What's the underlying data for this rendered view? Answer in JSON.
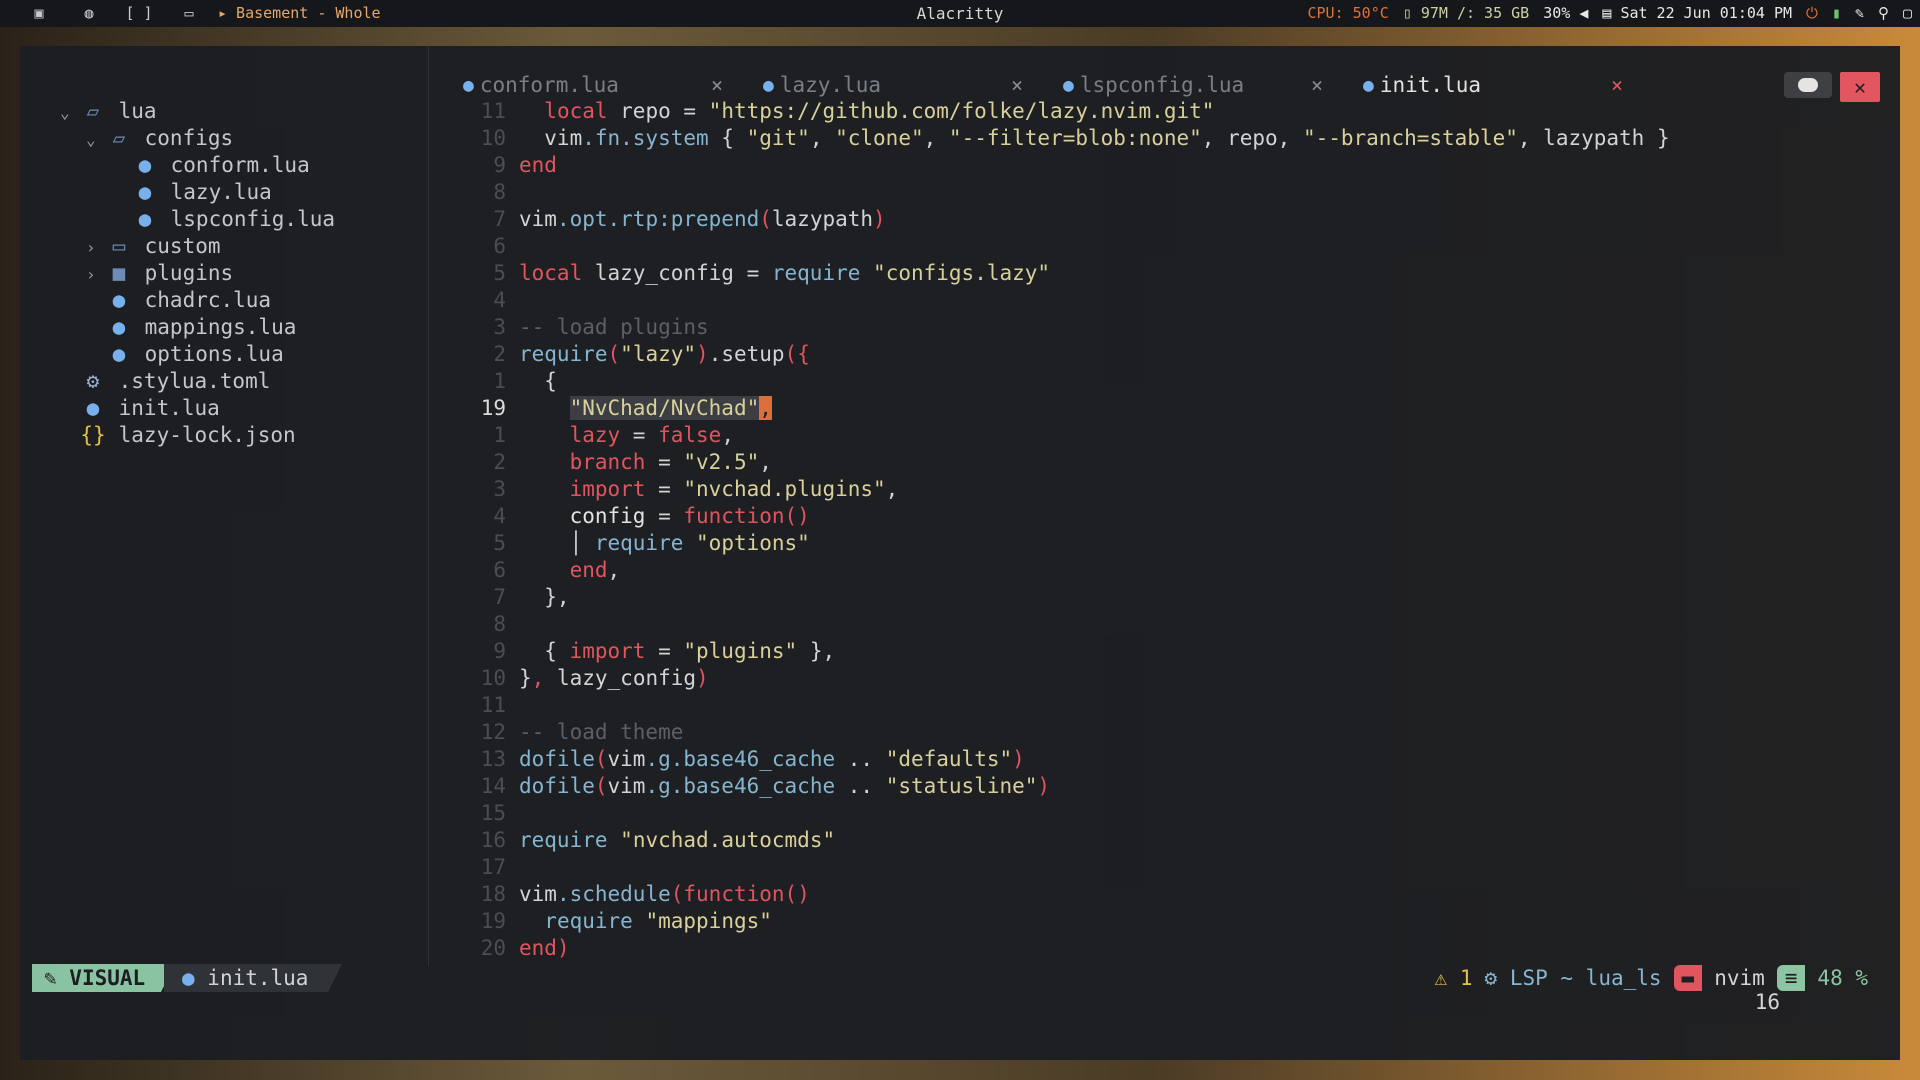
{
  "topbar": {
    "workspace": "▸ Basement - Whole",
    "title": "Alacritty",
    "cpu": "CPU: 50°C",
    "mem": "97M /: 35 GB",
    "volume": "30%",
    "datetime": "Sat 22 Jun 01:04 PM",
    "icons": [
      "terminal-icon",
      "globe-icon",
      "code-icon",
      "folder-icon"
    ]
  },
  "tree": [
    {
      "depth": 0,
      "open": true,
      "kind": "folder-open",
      "label": "lua"
    },
    {
      "depth": 1,
      "open": true,
      "kind": "folder-open",
      "label": "configs"
    },
    {
      "depth": 2,
      "kind": "lua",
      "label": "conform.lua"
    },
    {
      "depth": 2,
      "kind": "lua",
      "label": "lazy.lua"
    },
    {
      "depth": 2,
      "kind": "lua",
      "label": "lspconfig.lua"
    },
    {
      "depth": 1,
      "open": false,
      "kind": "folder",
      "label": "custom"
    },
    {
      "depth": 1,
      "open": false,
      "kind": "folder-filled",
      "label": "plugins"
    },
    {
      "depth": 1,
      "kind": "lua",
      "label": "chadrc.lua"
    },
    {
      "depth": 1,
      "kind": "lua",
      "label": "mappings.lua"
    },
    {
      "depth": 1,
      "kind": "lua",
      "label": "options.lua"
    },
    {
      "depth": 0,
      "kind": "gear",
      "label": ".stylua.toml"
    },
    {
      "depth": 0,
      "kind": "lua",
      "label": "init.lua"
    },
    {
      "depth": 0,
      "kind": "json",
      "label": "lazy-lock.json"
    }
  ],
  "tabs": [
    {
      "label": "conform.lua",
      "active": false
    },
    {
      "label": "lazy.lua",
      "active": false
    },
    {
      "label": "lspconfig.lua",
      "active": false
    },
    {
      "label": "init.lua",
      "active": true
    }
  ],
  "editor": {
    "lines": [
      {
        "n": "11",
        "t": [
          [
            "  ",
            ""
          ],
          [
            "local",
            "kw"
          ],
          [
            " repo = ",
            ""
          ],
          [
            "\"https://github.com/folke/lazy.nvim.git\"",
            "str"
          ]
        ]
      },
      {
        "n": "10",
        "t": [
          [
            "  vim",
            ""
          ],
          [
            ".fn.system",
            "fn"
          ],
          [
            " { ",
            ""
          ],
          [
            "\"git\"",
            "str"
          ],
          [
            ", ",
            ""
          ],
          [
            "\"clone\"",
            "str"
          ],
          [
            ", ",
            ""
          ],
          [
            "\"--filter=blob:none\"",
            "str"
          ],
          [
            ", repo, ",
            ""
          ],
          [
            "\"--branch=stable\"",
            "str"
          ],
          [
            ", lazypath }",
            ""
          ]
        ]
      },
      {
        "n": "9",
        "t": [
          [
            "end",
            "kw"
          ]
        ]
      },
      {
        "n": "8",
        "t": []
      },
      {
        "n": "7",
        "t": [
          [
            "vim",
            ""
          ],
          [
            ".opt.rtp:prepend",
            "fn"
          ],
          [
            "(",
            "pr"
          ],
          [
            "lazypath",
            ""
          ],
          [
            ")",
            "pr"
          ]
        ]
      },
      {
        "n": "6",
        "t": []
      },
      {
        "n": "5",
        "t": [
          [
            "local",
            "kw"
          ],
          [
            " lazy_config = ",
            ""
          ],
          [
            "require",
            "fn"
          ],
          [
            " ",
            ""
          ],
          [
            "\"configs.lazy\"",
            "str"
          ]
        ]
      },
      {
        "n": "4",
        "t": []
      },
      {
        "n": "3",
        "t": [
          [
            "-- load plugins",
            "cm"
          ]
        ]
      },
      {
        "n": "2",
        "t": [
          [
            "require",
            "fn"
          ],
          [
            "(",
            "pr"
          ],
          [
            "\"lazy\"",
            "str"
          ],
          [
            ")",
            "pr"
          ],
          [
            ".setup",
            ""
          ],
          [
            "({",
            "pr"
          ]
        ]
      },
      {
        "n": "1",
        "t": [
          [
            "  {",
            ""
          ]
        ]
      },
      {
        "n": "19",
        "cur": true,
        "t": [
          [
            "    ",
            ""
          ],
          [
            "\"NvChad/NvChad\"",
            "str hl"
          ],
          [
            ",",
            "cursor"
          ]
        ]
      },
      {
        "n": "1",
        "t": [
          [
            "    ",
            ""
          ],
          [
            "lazy",
            "kw"
          ],
          [
            " = ",
            ""
          ],
          [
            "false",
            "kw"
          ],
          [
            ",",
            ""
          ]
        ]
      },
      {
        "n": "2",
        "t": [
          [
            "    ",
            ""
          ],
          [
            "branch",
            "kw"
          ],
          [
            " = ",
            ""
          ],
          [
            "\"v2.5\"",
            "str"
          ],
          [
            ",",
            ""
          ]
        ]
      },
      {
        "n": "3",
        "t": [
          [
            "    ",
            ""
          ],
          [
            "import",
            "kw"
          ],
          [
            " = ",
            ""
          ],
          [
            "\"nvchad.plugins\"",
            "str"
          ],
          [
            ",",
            ""
          ]
        ]
      },
      {
        "n": "4",
        "t": [
          [
            "    ",
            ""
          ],
          [
            "config",
            "fld"
          ],
          [
            " = ",
            ""
          ],
          [
            "function",
            "kw"
          ],
          [
            "()",
            "pr"
          ]
        ]
      },
      {
        "n": "5",
        "t": [
          [
            "    │ ",
            ""
          ],
          [
            "require",
            "fn"
          ],
          [
            " ",
            ""
          ],
          [
            "\"options\"",
            "str"
          ]
        ]
      },
      {
        "n": "6",
        "t": [
          [
            "    ",
            ""
          ],
          [
            "end",
            "kw"
          ],
          [
            ",",
            ""
          ]
        ]
      },
      {
        "n": "7",
        "t": [
          [
            "  },",
            ""
          ]
        ]
      },
      {
        "n": "8",
        "t": []
      },
      {
        "n": "9",
        "t": [
          [
            "  { ",
            ""
          ],
          [
            "import",
            "kw"
          ],
          [
            " = ",
            ""
          ],
          [
            "\"plugins\"",
            "str"
          ],
          [
            " },",
            ""
          ]
        ]
      },
      {
        "n": "10",
        "t": [
          [
            "}",
            ""
          ],
          [
            ",",
            "kw"
          ],
          [
            " lazy_config",
            ""
          ],
          [
            ")",
            "pr"
          ]
        ]
      },
      {
        "n": "11",
        "t": []
      },
      {
        "n": "12",
        "t": [
          [
            "-- load theme",
            "cm"
          ]
        ]
      },
      {
        "n": "13",
        "t": [
          [
            "dofile",
            "fn"
          ],
          [
            "(",
            "pr"
          ],
          [
            "vim",
            ""
          ],
          [
            ".g.base46_cache",
            "fn"
          ],
          [
            " .. ",
            ""
          ],
          [
            "\"defaults\"",
            "str"
          ],
          [
            ")",
            "pr"
          ]
        ]
      },
      {
        "n": "14",
        "t": [
          [
            "dofile",
            "fn"
          ],
          [
            "(",
            "pr"
          ],
          [
            "vim",
            ""
          ],
          [
            ".g.base46_cache",
            "fn"
          ],
          [
            " .. ",
            ""
          ],
          [
            "\"statusline\"",
            "str"
          ],
          [
            ")",
            "pr"
          ]
        ]
      },
      {
        "n": "15",
        "t": []
      },
      {
        "n": "16",
        "t": [
          [
            "require",
            "fn"
          ],
          [
            " ",
            ""
          ],
          [
            "\"nvchad.autocmds\"",
            "str"
          ]
        ]
      },
      {
        "n": "17",
        "t": []
      },
      {
        "n": "18",
        "t": [
          [
            "vim",
            ""
          ],
          [
            ".schedule",
            "fn"
          ],
          [
            "(",
            "pr"
          ],
          [
            "function",
            "kw"
          ],
          [
            "()",
            "pr"
          ]
        ]
      },
      {
        "n": "19",
        "t": [
          [
            "  ",
            ""
          ],
          [
            "require",
            "fn"
          ],
          [
            " ",
            ""
          ],
          [
            "\"mappings\"",
            "str"
          ]
        ]
      },
      {
        "n": "20",
        "t": [
          [
            "end",
            "kw"
          ],
          [
            ")",
            "pr"
          ]
        ]
      }
    ]
  },
  "statusline": {
    "mode": "VISUAL",
    "file": "init.lua",
    "warnings": "1",
    "lsp": "LSP ~ lua_ls",
    "app": "nvim",
    "percent": "48 %"
  },
  "cmdline": "16"
}
